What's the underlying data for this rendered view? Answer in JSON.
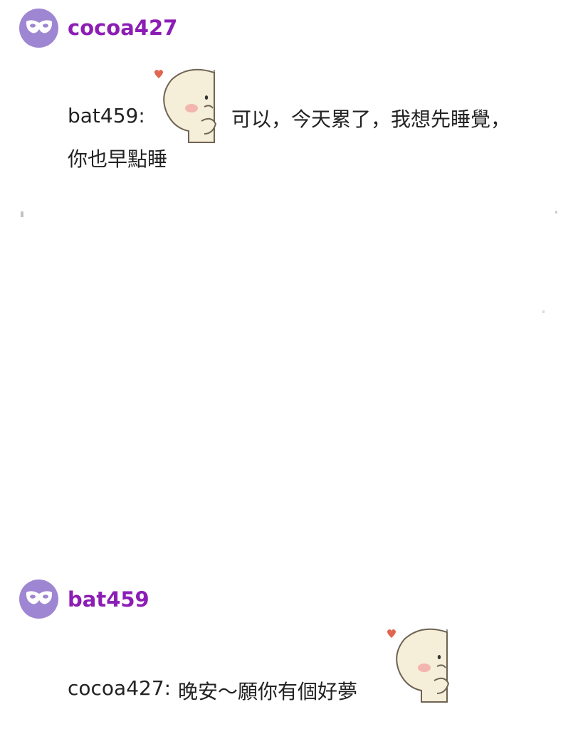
{
  "posts": [
    {
      "username": "cocoa427",
      "avatar_icon": "mask-icon",
      "message": {
        "prefix": "bat459:",
        "sticker": "peeking-bun-sticker",
        "text_line1": "可以，今天累了，我想先睡覺，",
        "text_line2": "你也早點睡"
      }
    },
    {
      "username": "bat459",
      "avatar_icon": "mask-icon",
      "message": {
        "prefix": "cocoa427:",
        "text": "晚安～願你有個好夢",
        "sticker": "peeking-bun-sticker"
      }
    }
  ],
  "colors": {
    "avatar_bg": "#9E86D2",
    "username": "#8C1DB5",
    "text": "#222222"
  }
}
